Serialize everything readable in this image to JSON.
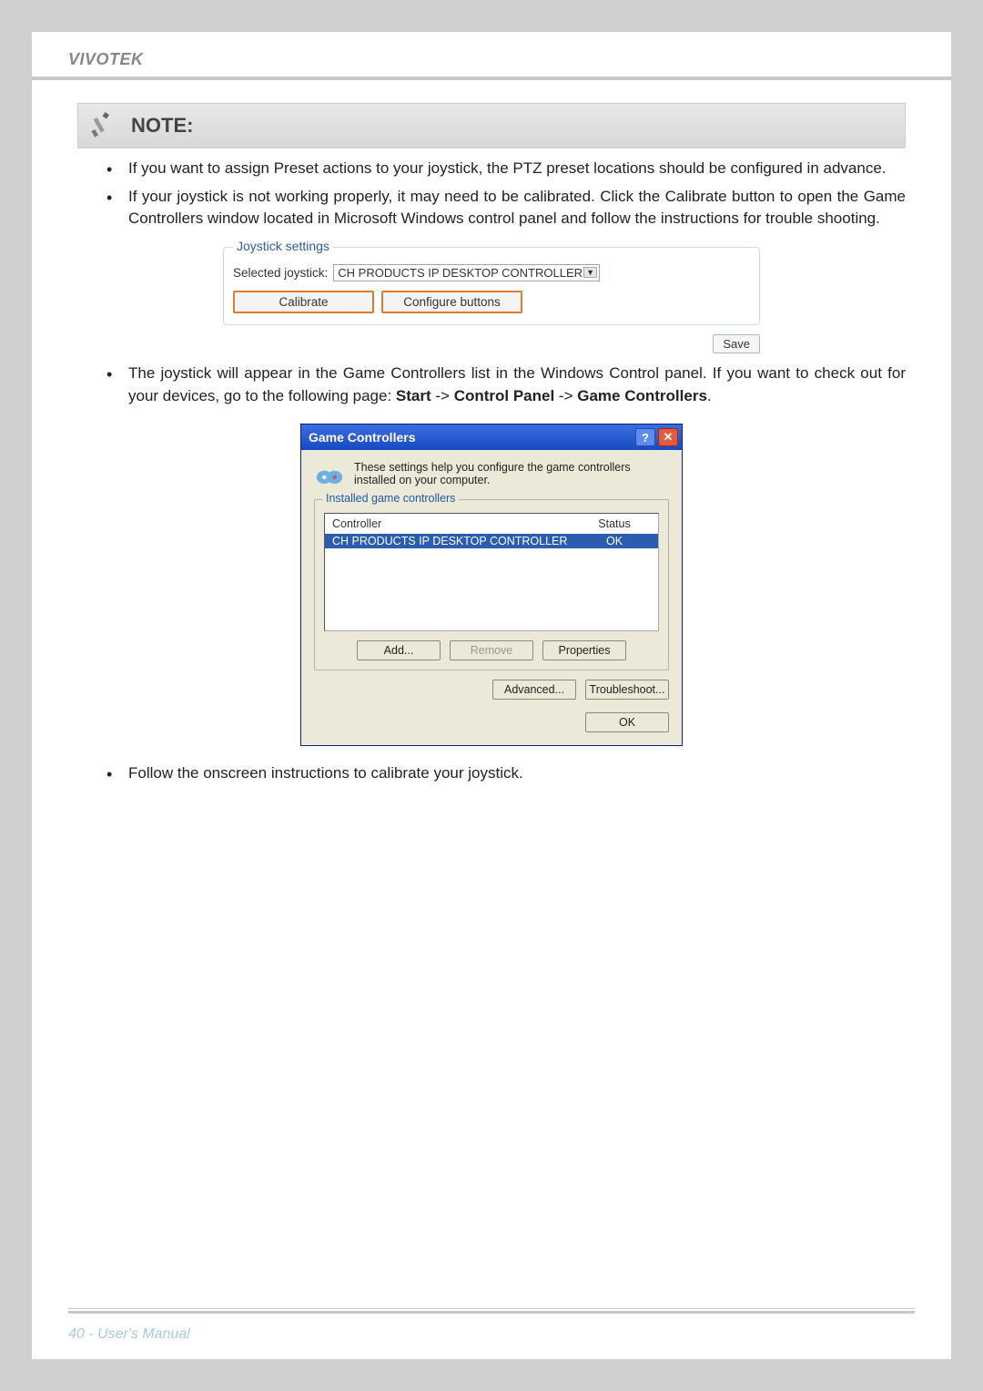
{
  "header": {
    "brand": "VIVOTEK"
  },
  "note": {
    "title": "NOTE:",
    "bullets": [
      "If you want to assign Preset actions to your joystick, the PTZ preset locations should be configured in advance.",
      "If your joystick is not working properly, it may need to be calibrated. Click the Calibrate button to open the Game Controllers window located in Microsoft Windows control panel and follow the instructions for trouble shooting."
    ]
  },
  "joystick_panel": {
    "legend": "Joystick settings",
    "label": "Selected joystick:",
    "selected": "CH PRODUCTS IP DESKTOP CONTROLLER",
    "calibrate": "Calibrate",
    "configure": "Configure buttons",
    "save": "Save"
  },
  "middle_text": {
    "prefix": "The joystick will appear in the Game Controllers list in the Windows Control panel. If you want to check out for your devices, go to the following page: ",
    "b1": "Start",
    "sep1": " -> ",
    "b2": "Control Panel",
    "sep2": " -> ",
    "b3": "Game Controllers",
    "suffix": "."
  },
  "dialog": {
    "title": "Game Controllers",
    "help_glyph": "?",
    "close_glyph": "✕",
    "intro": "These settings help you configure the game controllers installed on your computer.",
    "fs_legend": "Installed game controllers",
    "col_controller": "Controller",
    "col_status": "Status",
    "row_controller": "CH PRODUCTS IP DESKTOP CONTROLLER",
    "row_status": "OK",
    "btn_add": "Add...",
    "btn_remove": "Remove",
    "btn_properties": "Properties",
    "btn_advanced": "Advanced...",
    "btn_troubleshoot": "Troubleshoot...",
    "btn_ok": "OK"
  },
  "final_bullet": "Follow the onscreen instructions to calibrate your joystick.",
  "footer": {
    "page": "40 - User's Manual"
  }
}
